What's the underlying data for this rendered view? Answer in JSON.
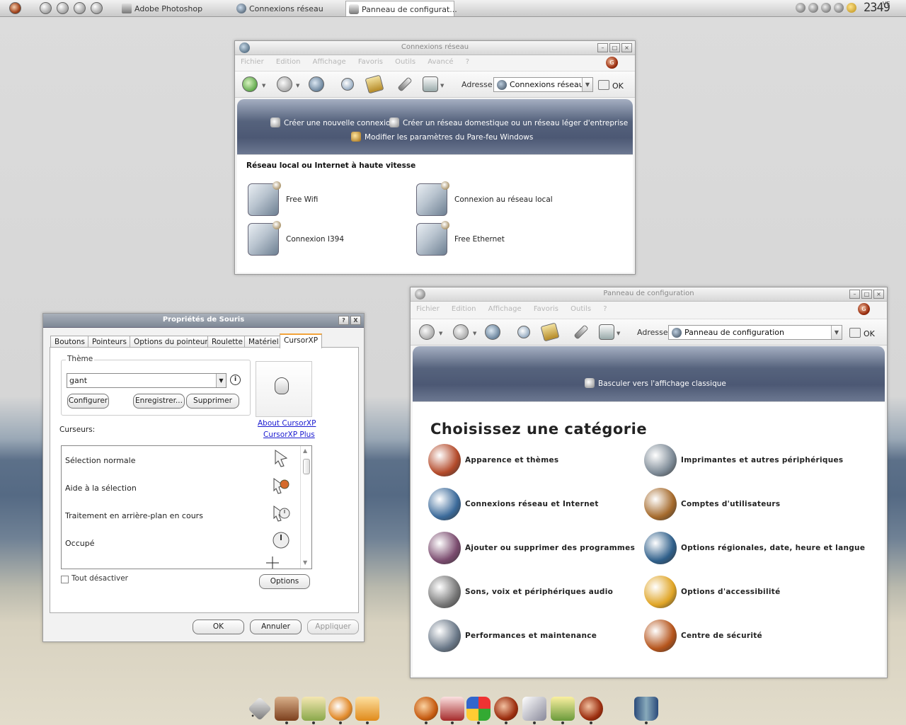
{
  "taskbar": {
    "tasks": [
      {
        "label": "Adobe Photoshop"
      },
      {
        "label": "Connexions réseau"
      },
      {
        "label": "Panneau de configurat..."
      }
    ],
    "clock": "2349",
    "clock_sub": "VE"
  },
  "net_window": {
    "title": "Connexions réseau",
    "menu": [
      "Fichier",
      "Edition",
      "Affichage",
      "Favoris",
      "Outils",
      "Avancé",
      "?"
    ],
    "address_label": "Adresse",
    "address_value": "Connexions réseau",
    "ok_label": "OK",
    "tasks": [
      "Créer une nouvelle connexion",
      "Créer un réseau domestique ou un réseau léger d'entreprise",
      "Modifier les paramètres du Pare-feu Windows"
    ],
    "section_title": "Réseau local ou Internet à haute vitesse",
    "connections": [
      "Free Wifi",
      "Connexion au réseau local",
      "Connexion I394",
      "Free Ethernet"
    ]
  },
  "cp_window": {
    "title": "Panneau de configuration",
    "menu": [
      "Fichier",
      "Edition",
      "Affichage",
      "Favoris",
      "Outils",
      "?"
    ],
    "address_label": "Adresse",
    "address_value": "Panneau de configuration",
    "ok_label": "OK",
    "switch_link": "Basculer vers l'affichage classique",
    "heading": "Choisissez une catégorie",
    "categories": [
      {
        "label": "Apparence et thèmes",
        "icon": "appearance-icon",
        "color": "#b34a2a"
      },
      {
        "label": "Imprimantes et autres périphériques",
        "icon": "printer-icon",
        "color": "#7d8a96"
      },
      {
        "label": "Connexions réseau et Internet",
        "icon": "network-icon",
        "color": "#3b6a9a"
      },
      {
        "label": "Comptes d'utilisateurs",
        "icon": "users-icon",
        "color": "#a56a2c"
      },
      {
        "label": "Ajouter ou supprimer des programmes",
        "icon": "programs-icon",
        "color": "#7a4b6e"
      },
      {
        "label": "Options régionales, date, heure et langue",
        "icon": "globe-icon",
        "color": "#2f5f8a"
      },
      {
        "label": "Sons, voix et périphériques audio",
        "icon": "speaker-icon",
        "color": "#777777"
      },
      {
        "label": "Options d'accessibilité",
        "icon": "accessibility-icon",
        "color": "#e0a526"
      },
      {
        "label": "Performances et maintenance",
        "icon": "maintenance-icon",
        "color": "#6a7888"
      },
      {
        "label": "Centre de sécurité",
        "icon": "security-icon",
        "color": "#b5541b"
      }
    ]
  },
  "mouse_dialog": {
    "title": "Propriétés de Souris",
    "help": "?",
    "close": "X",
    "tabs": [
      "Boutons",
      "Pointeurs",
      "Options du pointeur",
      "Roulette",
      "Matériel",
      "CursorXP"
    ],
    "theme_label": "Thème",
    "theme_value": "gant",
    "info_glyph": "i",
    "configure": "Configurer",
    "save": "Enregistrer...",
    "delete": "Supprimer",
    "about_link": "About CursorXP",
    "plus_link": "CursorXP Plus",
    "cursors_label": "Curseurs:",
    "cursors": [
      "Sélection normale",
      "Aide à la sélection",
      "Traitement en arrière-plan en cours",
      "Occupé"
    ],
    "disable_all": "Tout désactiver",
    "options": "Options",
    "ok": "OK",
    "cancel": "Annuler",
    "apply": "Appliquer"
  },
  "colors": {
    "header_blue": "#56637d",
    "link_blue": "#1a1ad0",
    "active_tab_accent": "#f2a33a"
  }
}
